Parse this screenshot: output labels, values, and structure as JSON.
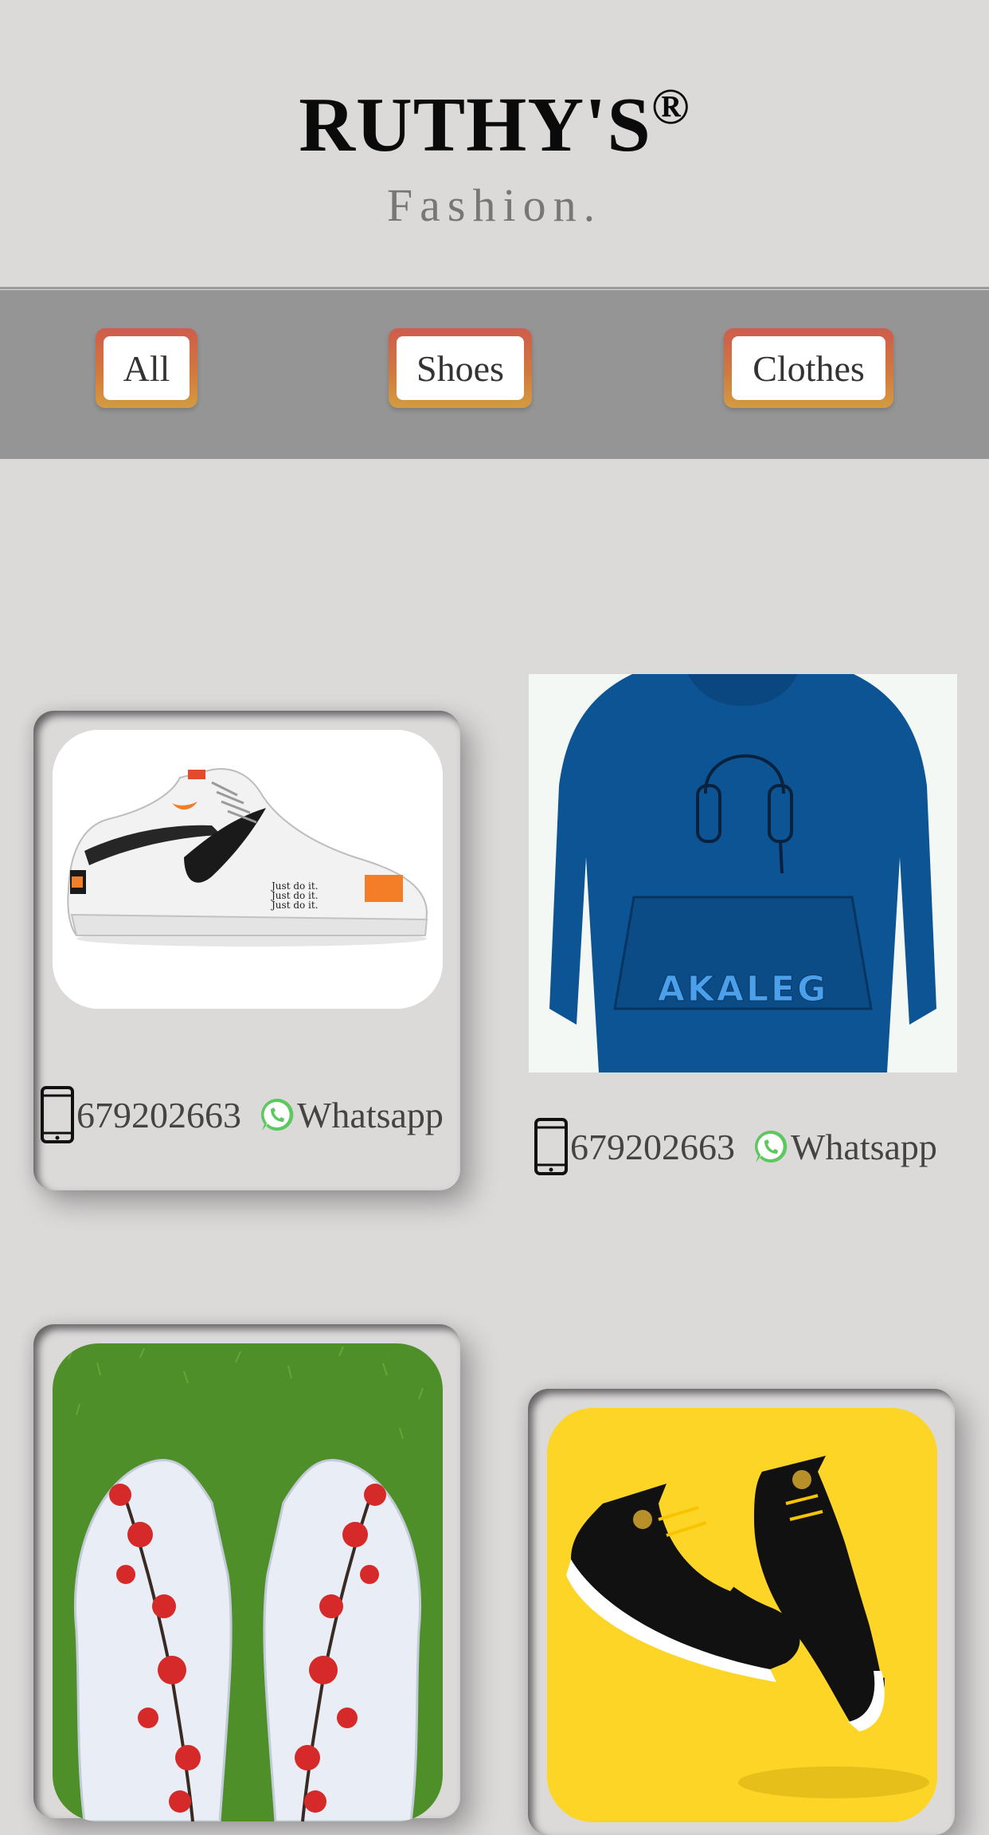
{
  "brand": {
    "name": "RUTHY'S",
    "mark": "®",
    "tagline": "Fashion."
  },
  "filters": [
    "All",
    "Shoes",
    "Clothes"
  ],
  "products": [
    {
      "image": "white-nike-air-force-1-just-do-it-sneaker",
      "phone": "679202663",
      "whatsapp": "Whatsapp"
    },
    {
      "image": "blue-akaleg-hoodie-headphones",
      "phone": "679202663",
      "whatsapp": "Whatsapp",
      "print_text": "AKALEG"
    },
    {
      "image": "white-sneakers-red-flower-embroidery-on-grass"
    },
    {
      "image": "yellow-black-jordan-1-sneakers"
    }
  ],
  "icons": {
    "phone": "smartphone-icon",
    "whatsapp": "whatsapp-icon"
  },
  "colors": {
    "background": "#dcd9d9",
    "nav": "#969595",
    "button_border": "#d0793e",
    "whatsapp": "#5cc860",
    "hoodie": "#0d5495",
    "sneaker_yellow": "#fdd527"
  }
}
